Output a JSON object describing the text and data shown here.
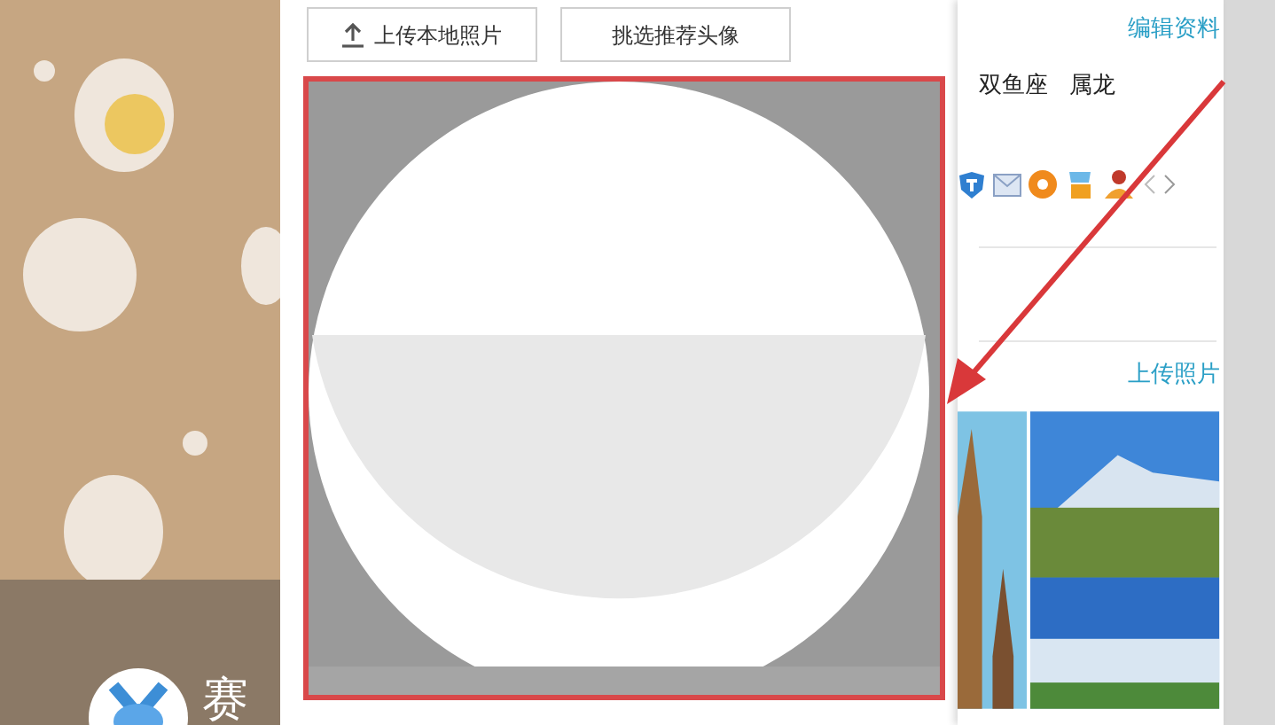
{
  "background": {
    "user_name": "赛"
  },
  "dialog": {
    "buttons": [
      {
        "label": "上传本地照片",
        "kind": "upload"
      },
      {
        "label": "挑选推荐头像",
        "kind": "plain"
      }
    ]
  },
  "profile": {
    "edit_link": "编辑资料",
    "tags": [
      "双鱼座",
      "属龙"
    ],
    "upload_link": "上传照片"
  }
}
